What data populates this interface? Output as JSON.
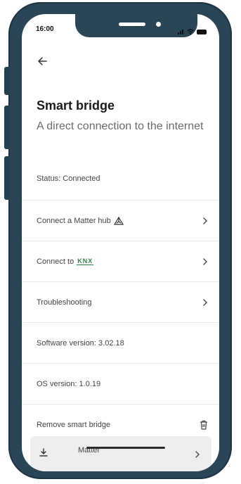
{
  "status_bar": {
    "time": "16:00"
  },
  "header": {
    "title": "Smart bridge",
    "subtitle": "A direct connection to the internet"
  },
  "rows": {
    "status": "Status: Connected",
    "matter_hub": "Connect a Matter hub",
    "knx_prefix": "Connect to",
    "knx_logo": "KNX",
    "troubleshooting": "Troubleshooting",
    "software_version": "Software version: 3.02.18",
    "os_version": "OS version: 1.0.19",
    "remove": "Remove smart bridge"
  },
  "bottom_card": {
    "label": "Matter"
  },
  "icons": {
    "back": "arrow-left-icon",
    "matter": "matter-logo-icon",
    "chevron": "chevron-right-icon",
    "trash": "trash-icon",
    "download": "download-icon"
  },
  "colors": {
    "frame": "#2a4555",
    "knx": "#2b8a4a"
  }
}
